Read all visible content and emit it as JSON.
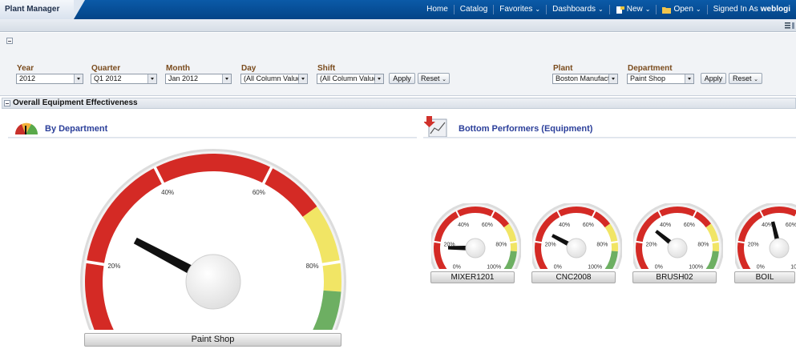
{
  "app": {
    "title": "Plant Manager"
  },
  "nav": {
    "home": "Home",
    "catalog": "Catalog",
    "favorites": "Favorites",
    "dashboards": "Dashboards",
    "new": "New",
    "open": "Open",
    "signed_in_as": "Signed In As",
    "user": "weblogi"
  },
  "prompts": {
    "left": {
      "year": {
        "label": "Year",
        "value": "2012"
      },
      "quarter": {
        "label": "Quarter",
        "value": "Q1 2012"
      },
      "month": {
        "label": "Month",
        "value": "Jan 2012"
      },
      "day": {
        "label": "Day",
        "value": "(All Column Values)"
      },
      "shift": {
        "label": "Shift",
        "value": "(All Column Values)"
      },
      "apply": "Apply",
      "reset": "Reset"
    },
    "right": {
      "plant": {
        "label": "Plant",
        "value": "Boston Manufact"
      },
      "department": {
        "label": "Department",
        "value": "Paint Shop"
      },
      "apply": "Apply",
      "reset": "Reset"
    }
  },
  "section": {
    "title": "Overall Equipment Effectiveness"
  },
  "views": {
    "by_department": {
      "title": "By Department"
    },
    "bottom_performers": {
      "title": "Bottom Performers (Equipment)"
    }
  },
  "gauge_ticks": [
    "0%",
    "20%",
    "40%",
    "60%",
    "80%",
    "100%"
  ],
  "colors": {
    "red": "#d42a25",
    "yellow": "#f1e565",
    "green": "#6daf62",
    "nav": "#0b5aa8",
    "title_blue": "#2b3f9a",
    "label_brown": "#7a4b1d"
  },
  "main_gauge": {
    "label": "Paint Shop",
    "value_pct": 27
  },
  "small_gauges": [
    {
      "label": "MIXER1201",
      "value_pct": 17
    },
    {
      "label": "CNC2008",
      "value_pct": 27
    },
    {
      "label": "BRUSH02",
      "value_pct": 31
    },
    {
      "label": "BOIL",
      "value_pct": 45
    }
  ]
}
